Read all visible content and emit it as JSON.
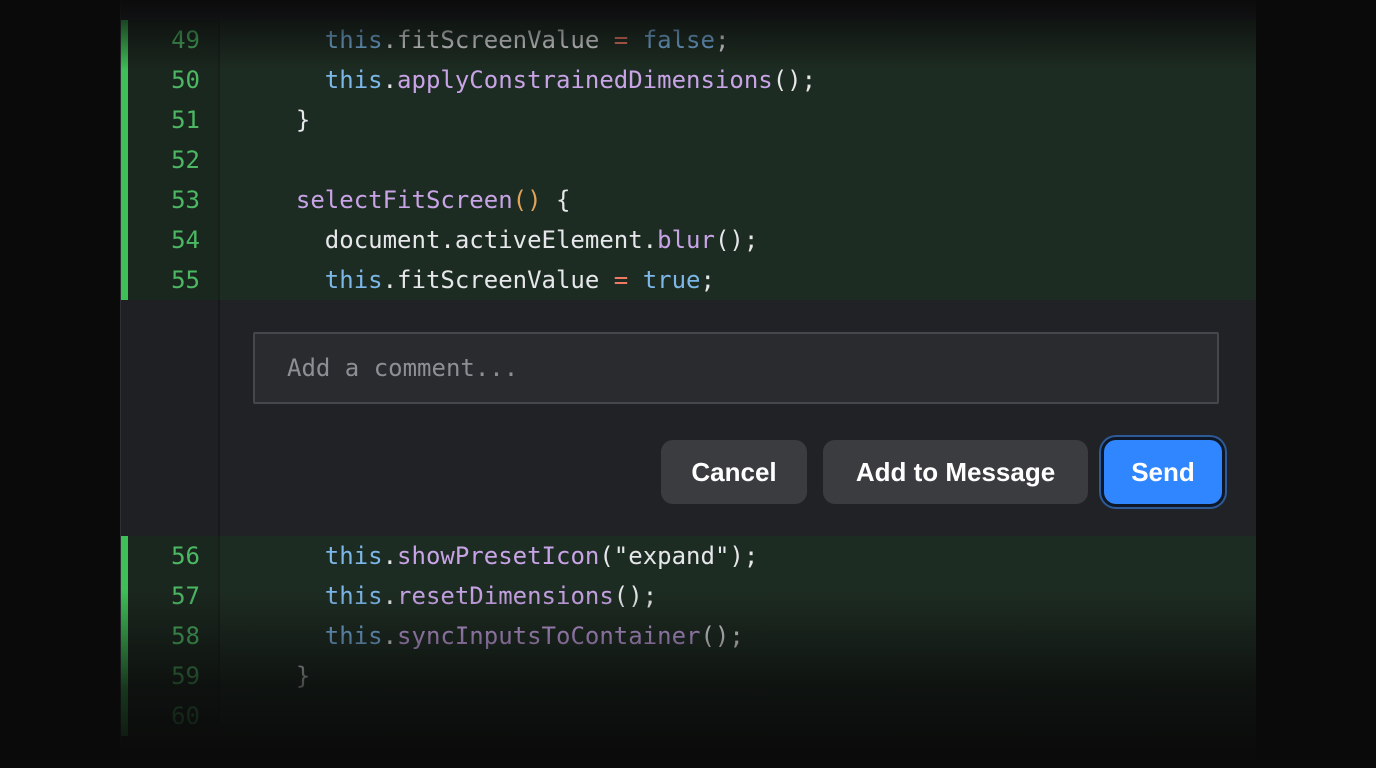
{
  "code_lines_top": [
    {
      "num": "49",
      "tokens": [
        [
          "plain",
          "    "
        ],
        [
          "this",
          "this"
        ],
        [
          "plain",
          ".fitScreenValue "
        ],
        [
          "op",
          "="
        ],
        [
          "plain",
          " "
        ],
        [
          "bool",
          "false"
        ],
        [
          "plain",
          ";"
        ]
      ]
    },
    {
      "num": "50",
      "tokens": [
        [
          "plain",
          "    "
        ],
        [
          "this",
          "this"
        ],
        [
          "plain",
          "."
        ],
        [
          "fn",
          "applyConstrainedDimensions"
        ],
        [
          "plain",
          "();"
        ]
      ]
    },
    {
      "num": "51",
      "tokens": [
        [
          "plain",
          "  }"
        ]
      ]
    },
    {
      "num": "52",
      "tokens": [
        [
          "plain",
          ""
        ]
      ]
    },
    {
      "num": "53",
      "tokens": [
        [
          "plain",
          "  "
        ],
        [
          "fn",
          "selectFitScreen"
        ],
        [
          "paren",
          "()"
        ],
        [
          "plain",
          " {"
        ]
      ]
    },
    {
      "num": "54",
      "tokens": [
        [
          "plain",
          "    document.activeElement."
        ],
        [
          "fn",
          "blur"
        ],
        [
          "plain",
          "();"
        ]
      ]
    },
    {
      "num": "55",
      "tokens": [
        [
          "plain",
          "    "
        ],
        [
          "this",
          "this"
        ],
        [
          "plain",
          ".fitScreenValue "
        ],
        [
          "op",
          "="
        ],
        [
          "plain",
          " "
        ],
        [
          "bool",
          "true"
        ],
        [
          "plain",
          ";"
        ]
      ]
    }
  ],
  "code_lines_bottom": [
    {
      "num": "56",
      "tokens": [
        [
          "plain",
          "    "
        ],
        [
          "this",
          "this"
        ],
        [
          "plain",
          "."
        ],
        [
          "fn",
          "showPresetIcon"
        ],
        [
          "plain",
          "(\"expand\");"
        ]
      ]
    },
    {
      "num": "57",
      "tokens": [
        [
          "plain",
          "    "
        ],
        [
          "this",
          "this"
        ],
        [
          "plain",
          "."
        ],
        [
          "fn",
          "resetDimensions"
        ],
        [
          "plain",
          "();"
        ]
      ]
    },
    {
      "num": "58",
      "tokens": [
        [
          "plain",
          "    "
        ],
        [
          "this",
          "this"
        ],
        [
          "plain",
          "."
        ],
        [
          "fn",
          "syncInputsToContainer"
        ],
        [
          "plain",
          "();"
        ]
      ]
    },
    {
      "num": "59",
      "tokens": [
        [
          "plain",
          "  }"
        ]
      ]
    },
    {
      "num": "60",
      "tokens": [
        [
          "plain",
          ""
        ]
      ]
    }
  ],
  "comment": {
    "placeholder": "Add a comment...",
    "value": "",
    "cancel_label": "Cancel",
    "add_label": "Add to Message",
    "send_label": "Send"
  },
  "colors": {
    "added_bar": "#3fbf57",
    "send_button": "#2f86ff",
    "secondary_button": "#3a3c40"
  }
}
